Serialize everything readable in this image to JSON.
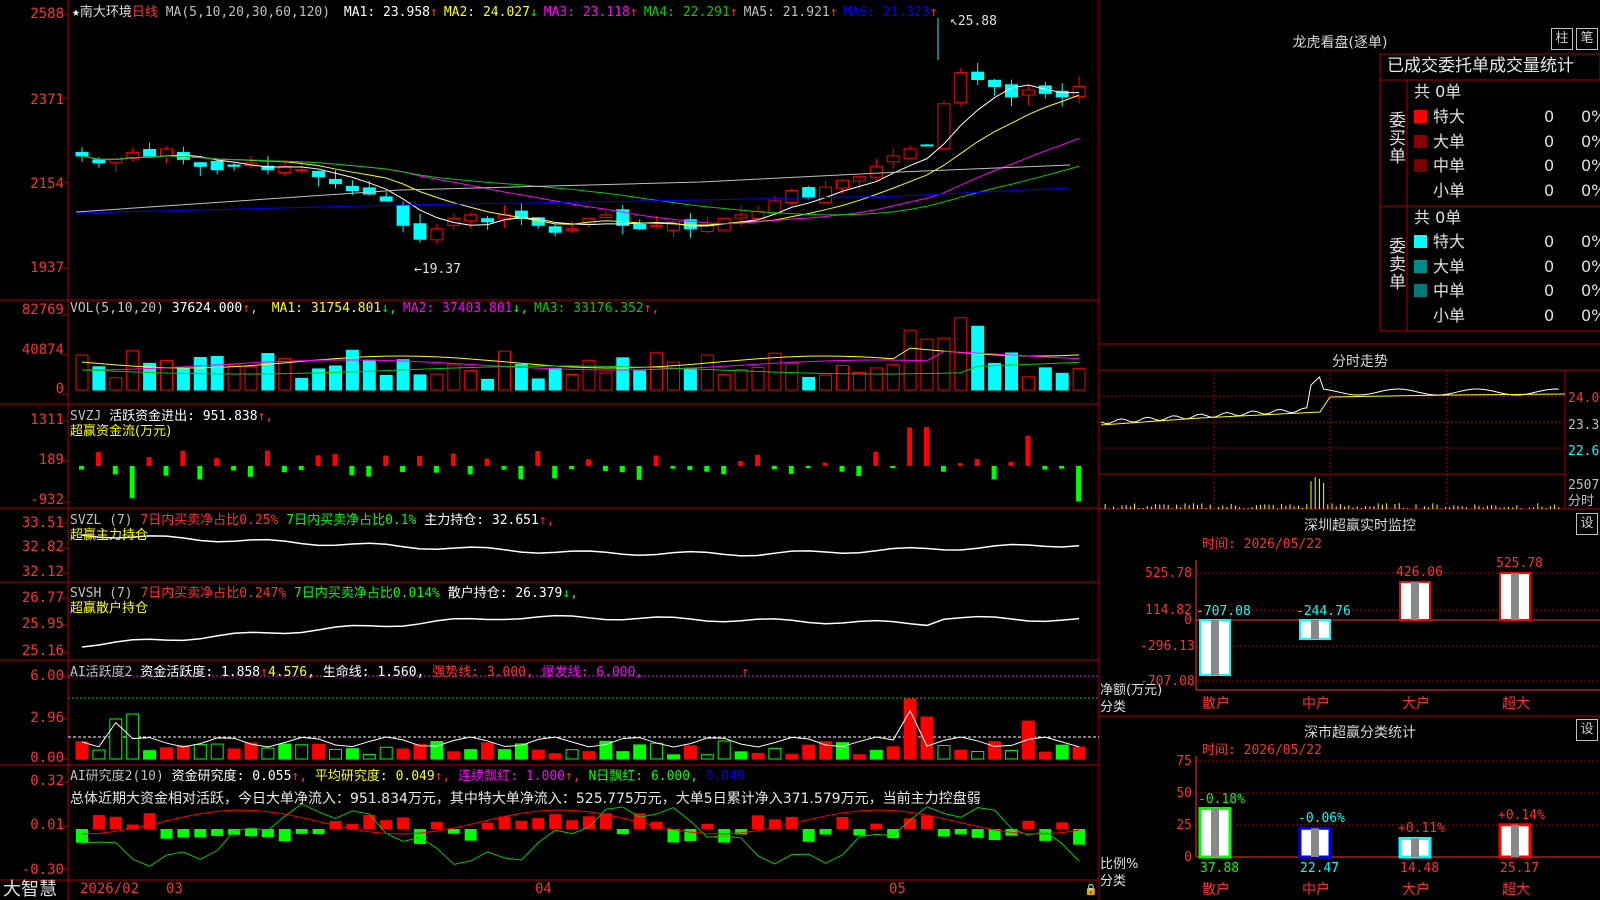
{
  "stock": {
    "star": "★",
    "name": "南大环境",
    "period": "日线"
  },
  "price_panel": {
    "ma_label": "MA(5,10,20,30,60,120)",
    "ma": [
      {
        "label": "MA1:",
        "value": "23.958",
        "arrow": "↑",
        "color": "#ffffff"
      },
      {
        "label": "MA2:",
        "value": "24.027",
        "arrow": "↓",
        "color": "#ffff00"
      },
      {
        "label": "MA3:",
        "value": "23.118",
        "arrow": "↑",
        "color": "#ff00ff"
      },
      {
        "label": "MA4:",
        "value": "22.291",
        "arrow": "↑",
        "color": "#00cc00"
      },
      {
        "label": "MA5:",
        "value": "21.921",
        "arrow": "↑",
        "color": "#c0c0c0"
      },
      {
        "label": "MA6:",
        "value": "21.323",
        "arrow": "↑",
        "color": "#0000ff"
      }
    ],
    "y_ticks": [
      "2588",
      "2371",
      "2154",
      "1937"
    ],
    "high_note": "25.88",
    "low_note": "←19.37"
  },
  "vol_panel": {
    "label": "VOL(5,10,20)",
    "value": "37624.000",
    "arrow": "↑",
    "ma": [
      {
        "label": "MA1:",
        "value": "31754.801",
        "arrow": "↓",
        "color": "#ffff00"
      },
      {
        "label": "MA2:",
        "value": "37403.801",
        "arrow": "↓",
        "color": "#ff00ff"
      },
      {
        "label": "MA3:",
        "value": "33176.352",
        "arrow": "↑",
        "color": "#00cc00"
      }
    ],
    "y_ticks": [
      "82769",
      "40874",
      "0"
    ]
  },
  "svzj_panel": {
    "label": "SVZJ",
    "text": "活跃资金进出:",
    "value": "951.838",
    "arrow": "↑,",
    "sub": "超赢资金流(万元)",
    "y_ticks": [
      "1311",
      "189",
      "-932"
    ]
  },
  "svzl_panel": {
    "label": "SVZL (7)",
    "a": "7日内买卖净占比0.25%",
    "b": "7日内买卖净占比0.1%",
    "c": "主力持仓:",
    "value": "32.651",
    "arrow": "↑,",
    "sub": "超赢主力持仓",
    "y_ticks": [
      "33.51",
      "32.82",
      "32.12"
    ]
  },
  "svsh_panel": {
    "label": "SVSH (7)",
    "a": "7日内买卖净占比0.247%",
    "b": "7日内买卖净占比0.014%",
    "c": "散户持仓:",
    "value": "26.379",
    "arrow": "↓,",
    "sub": "超赢散户持仓",
    "y_ticks": [
      "26.77",
      "25.95",
      "25.16"
    ]
  },
  "ai_active_panel": {
    "label": "AI活跃度2",
    "text": "资金活跃度:",
    "value": "1.858",
    "v2": "4.576,",
    "life": "生命线:",
    "life_v": "1.560,",
    "strong": "强势线:",
    "strong_v": "3.000,",
    "burst": "爆发线:",
    "burst_v": "6.000,",
    "arrow": "↑",
    "y_ticks": [
      "6.00",
      "2.96",
      "0.00"
    ]
  },
  "ai_research_panel": {
    "label": "AI研究度2(10)",
    "text": "资金研究度:",
    "value": "0.055",
    "avg": "平均研究度:",
    "avg_v": "0.049",
    "red": "连续飘红:",
    "red_v": "1.000",
    "nred": "N日飘红:",
    "nred_v": "6.000,",
    "v5": "0.049",
    "summary": "总体近期大资金相对活跃，今日大单净流入：951.834万元，其中特大单净流入：525.775万元，大单5日累计净入371.579万元，当前主力控盘弱",
    "y_ticks": [
      "0.32",
      "0.01",
      "-0.30"
    ]
  },
  "bottom_bar": {
    "logo": "大智慧",
    "dates": [
      "2026/02",
      "03",
      "04",
      "05"
    ]
  },
  "right": {
    "longhu_title": "龙虎看盘(逐单)",
    "btn_zhu": "柱",
    "btn_bi": "笔",
    "tabs": [
      "已成交",
      "委托单",
      "成交量统计"
    ],
    "buy": {
      "side": "委买单",
      "total": "共 0单",
      "rows": [
        {
          "label": "特大",
          "n": "0",
          "pct": "0%",
          "color": "#ff0000"
        },
        {
          "label": "大单",
          "n": "0",
          "pct": "0%",
          "color": "#8b0000"
        },
        {
          "label": "中单",
          "n": "0",
          "pct": "0%",
          "color": "#7a0000"
        },
        {
          "label": "小单",
          "n": "0",
          "pct": "0%",
          "color": "#000000"
        }
      ]
    },
    "sell": {
      "side": "委卖单",
      "total": "共 0单",
      "rows": [
        {
          "label": "特大",
          "n": "0",
          "pct": "0%",
          "color": "#00ffff"
        },
        {
          "label": "大单",
          "n": "0",
          "pct": "0%",
          "color": "#008b8b"
        },
        {
          "label": "中单",
          "n": "0",
          "pct": "0%",
          "color": "#007a7a"
        },
        {
          "label": "小单",
          "n": "0",
          "pct": "0%",
          "color": "#000000"
        }
      ]
    },
    "fenshi": {
      "title": "分时走势",
      "y_ticks": [
        "24.02",
        "23.32",
        "22.62",
        "2507"
      ],
      "unit": "分时"
    },
    "sz_monitor": {
      "title": "深圳超赢实时监控",
      "btn": "设",
      "date": "时间: 2026/05/22",
      "y_ticks": [
        "525.78",
        "114.82",
        "0",
        "-296.13",
        "-707.08"
      ],
      "ylabel": "净额(万元)",
      "xlabel": "分类",
      "categories": [
        "散户",
        "中户",
        "大户",
        "超大"
      ],
      "values": [
        -707.08,
        -244.76,
        426.06,
        525.78
      ],
      "value_labels": [
        "-707.08",
        "-244.76",
        "426.06",
        "525.78"
      ]
    },
    "sz_class": {
      "title": "深市超赢分类统计",
      "btn": "设",
      "date": "时间: 2026/05/22",
      "y_ticks": [
        "75",
        "50",
        "25",
        "0"
      ],
      "ylabel": "比例%",
      "xlabel": "分类",
      "categories": [
        "散户",
        "中户",
        "大户",
        "超大"
      ],
      "values": [
        37.88,
        22.47,
        14.48,
        25.17
      ],
      "changes": [
        "-0.18%",
        "-0.06%",
        "+0.11%",
        "+0.14%"
      ]
    }
  },
  "chart_data": [
    {
      "type": "bar",
      "title": "深圳超赢实时监控",
      "ylabel": "净额(万元)",
      "xlabel": "分类",
      "categories": [
        "散户",
        "中户",
        "大户",
        "超大"
      ],
      "values": [
        -707.08,
        -244.76,
        426.06,
        525.78
      ],
      "ylim": [
        -707.08,
        525.78
      ]
    },
    {
      "type": "bar",
      "title": "深市超赢分类统计",
      "ylabel": "比例%",
      "xlabel": "分类",
      "categories": [
        "散户",
        "中户",
        "大户",
        "超大"
      ],
      "values": [
        37.88,
        22.47,
        14.48,
        25.17
      ],
      "ylim": [
        0,
        75
      ]
    }
  ],
  "colors": {
    "up": "#ff0000",
    "down": "#00ffff",
    "grid": "#b00000",
    "text": "#c0c0c0"
  }
}
